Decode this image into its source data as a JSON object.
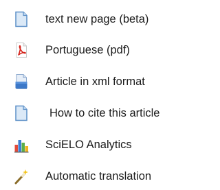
{
  "menu": {
    "items": [
      {
        "label": "text new page (beta)",
        "icon": "page-icon"
      },
      {
        "label": "Portuguese (pdf)",
        "icon": "pdf-icon"
      },
      {
        "label": "Article in xml format",
        "icon": "xml-icon"
      },
      {
        "label": "How to cite this article",
        "icon": "page-icon"
      },
      {
        "label": "SciELO Analytics",
        "icon": "bar-chart-icon"
      },
      {
        "label": "Automatic translation",
        "icon": "magic-wand-icon"
      }
    ]
  },
  "colors": {
    "page_icon_fill": "#dbe9f7",
    "page_icon_stroke": "#5b8fc7",
    "pdf_red": "#d4241c",
    "xml_blue": "#3c78c8"
  }
}
